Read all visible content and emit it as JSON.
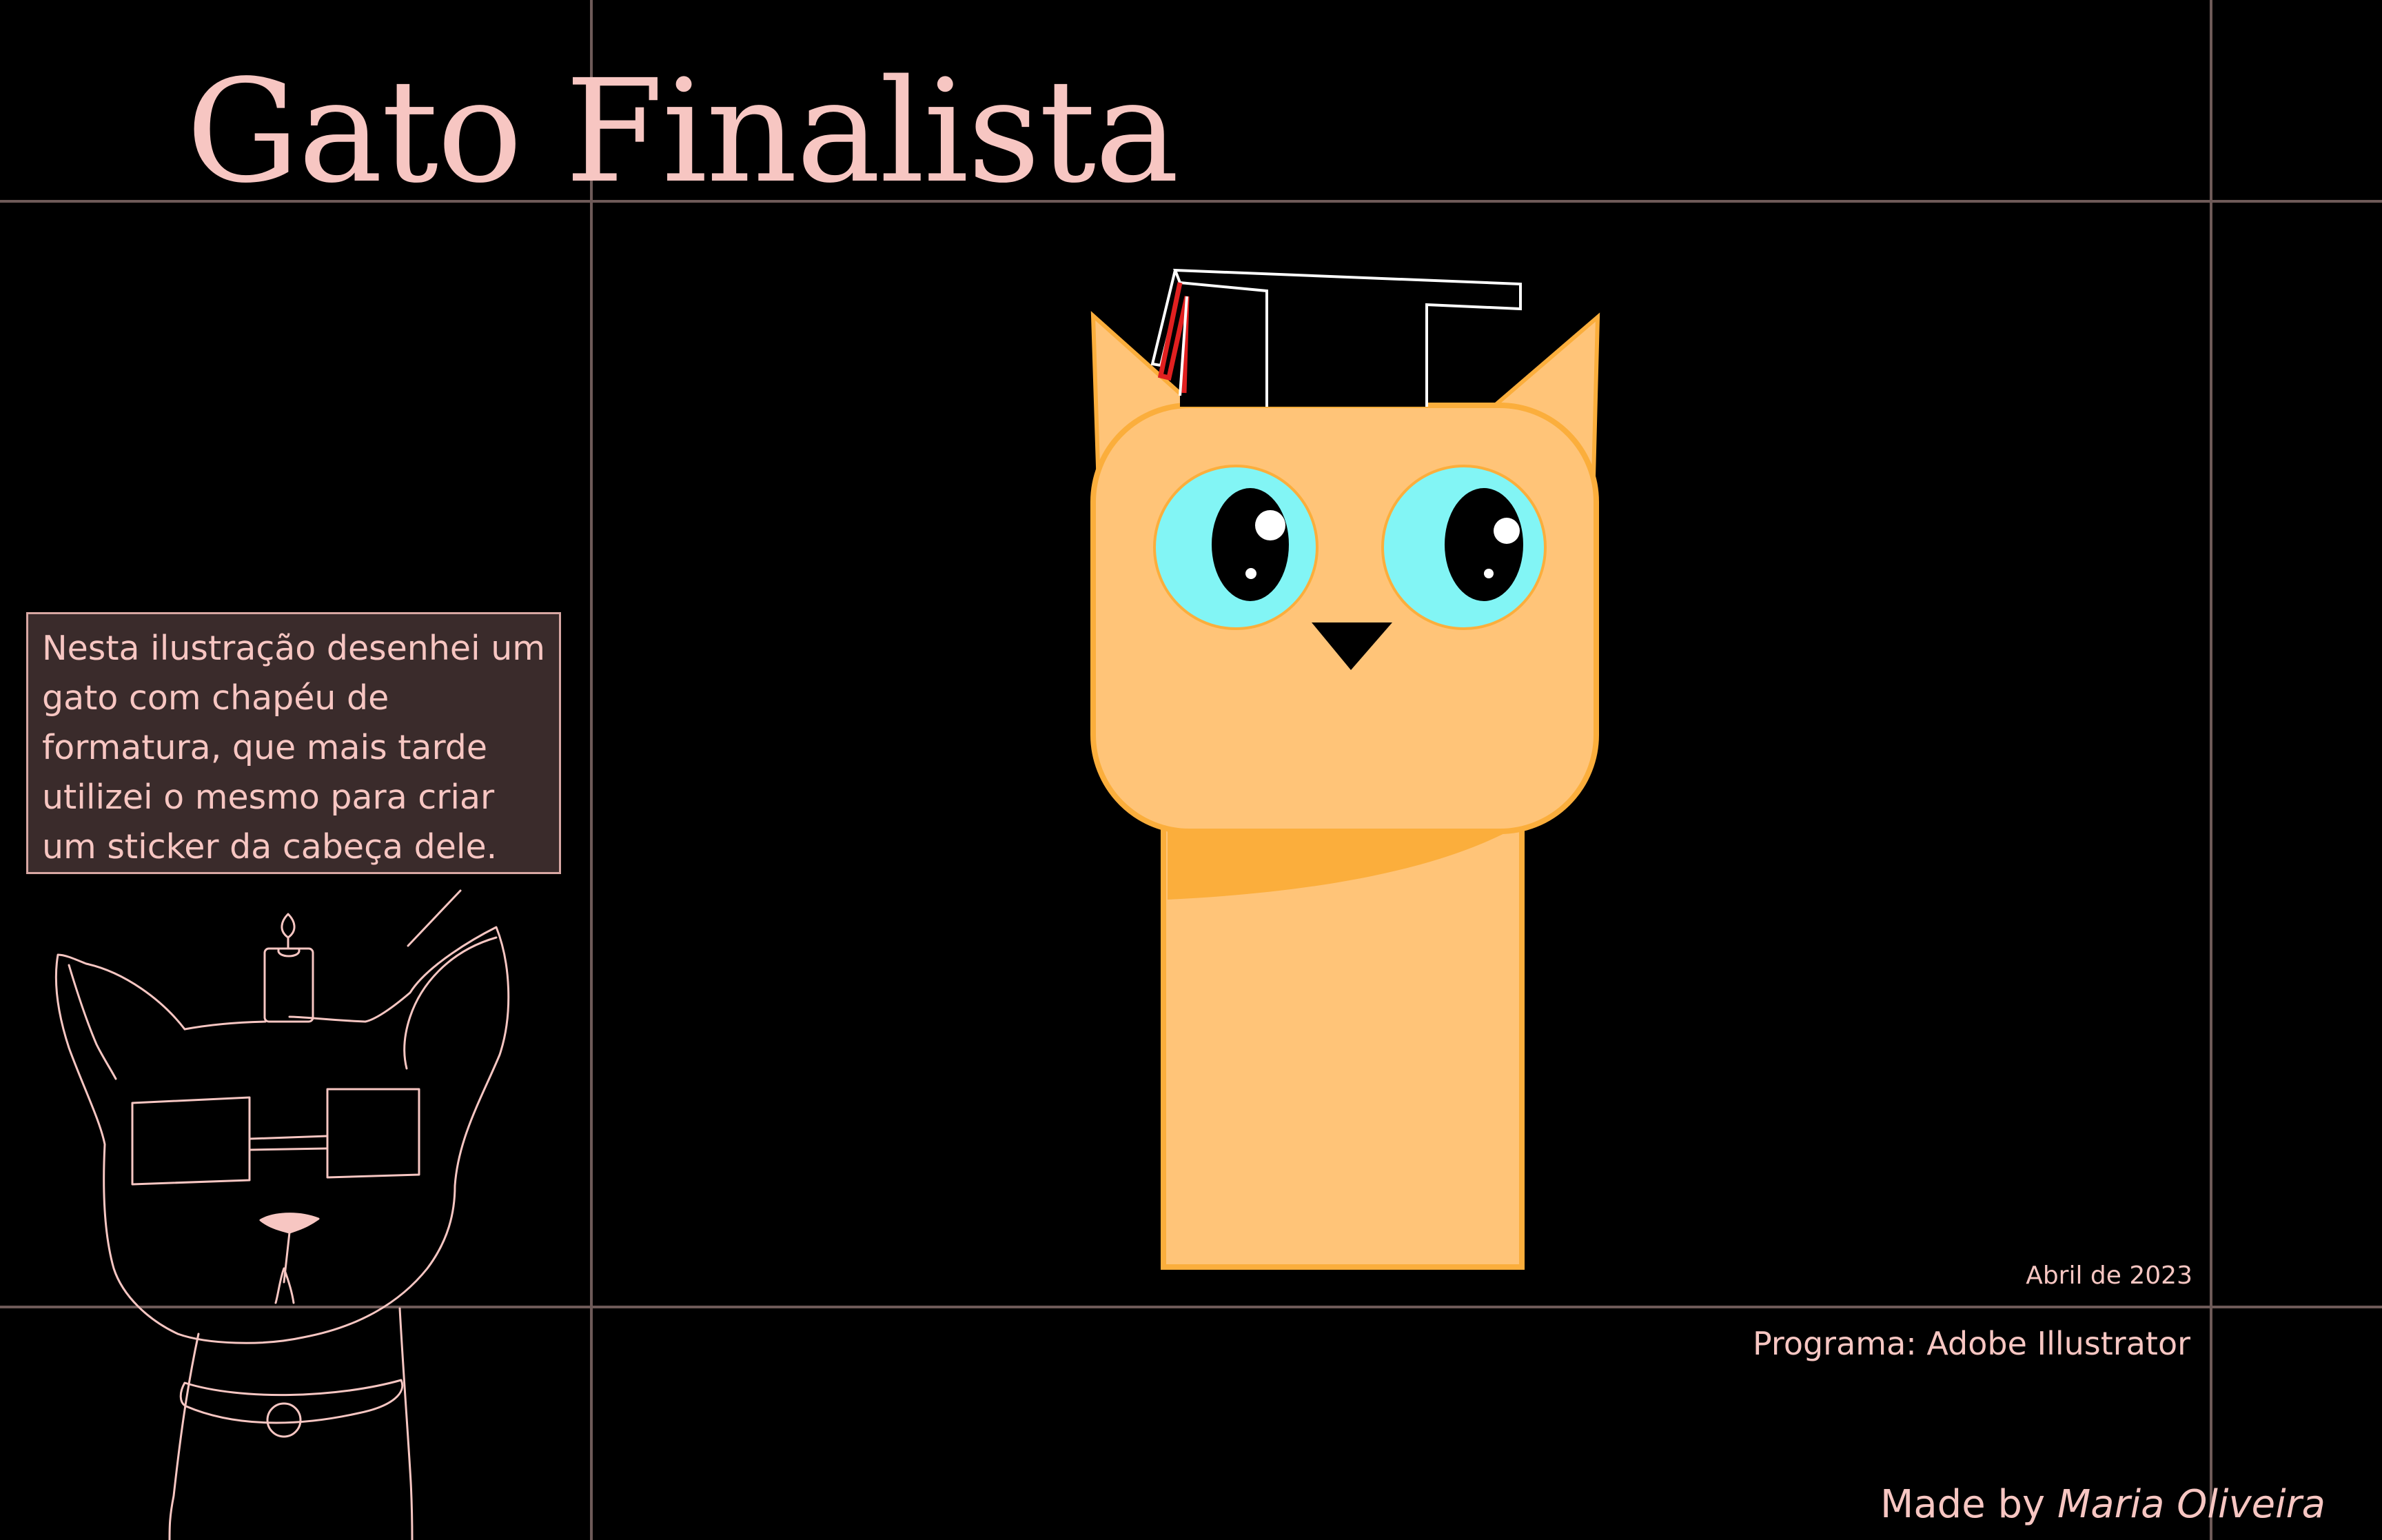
{
  "title": "Gato Finalista",
  "caption": {
    "lines": [
      "Nesta ilustração desenhei um",
      "gato com chapéu de",
      "formatura, que mais tarde",
      "utilizei o mesmo para criar",
      "um sticker da cabeça dele."
    ]
  },
  "info": {
    "date": "Abril de 2023",
    "program": "Programa: Adobe Illustrator"
  },
  "signature": {
    "prefix": "Made by ",
    "author": "Maria Oliveira"
  },
  "colors": {
    "background": "#000000",
    "text_pink": "#f7c6c2",
    "grid_line": "#6e5a58",
    "caption_box_fill": "#3a2b2b",
    "cat_fur": "#ffc478",
    "cat_outline": "#fbae3c",
    "cat_eye": "#82f5f5",
    "line_art": "#f7c6c2"
  },
  "icons": {
    "main_illustration": "graduate-cat-illustration",
    "mascot": "line-art-cat-with-sunglasses-and-candle"
  }
}
